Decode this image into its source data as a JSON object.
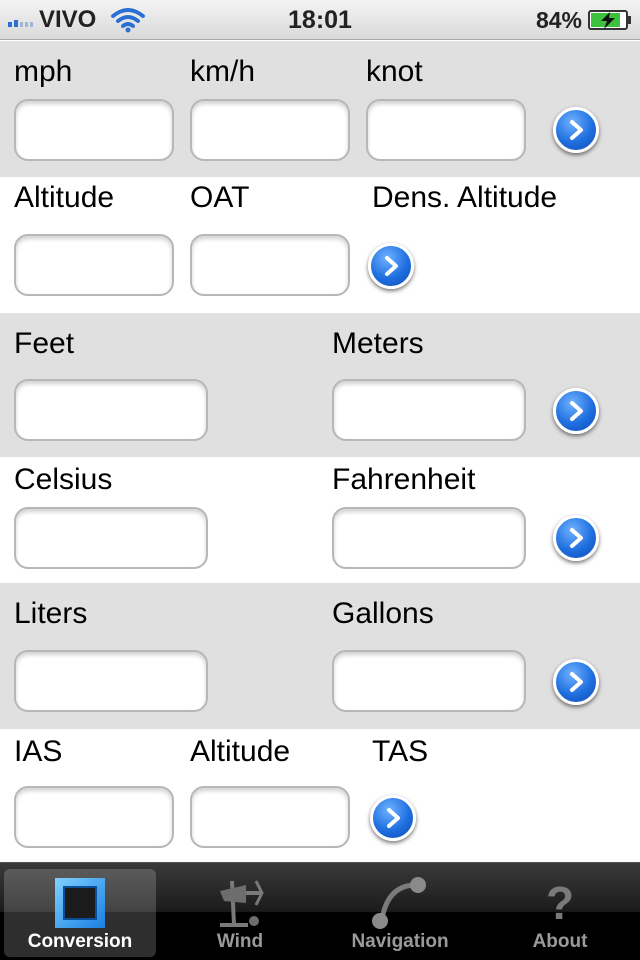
{
  "status_bar": {
    "carrier": "VIVO",
    "time": "18:01",
    "battery": "84%"
  },
  "rows": [
    {
      "labels": [
        "mph",
        "km/h",
        "knot"
      ]
    },
    {
      "labels": [
        "Altitude",
        "OAT",
        "Dens. Altitude"
      ]
    },
    {
      "labels": [
        "Feet",
        "Meters"
      ]
    },
    {
      "labels": [
        "Celsius",
        "Fahrenheit"
      ]
    },
    {
      "labels": [
        "Liters",
        "Gallons"
      ]
    },
    {
      "labels": [
        "IAS",
        "Altitude",
        "TAS"
      ]
    }
  ],
  "tabs": [
    {
      "label": "Conversion",
      "icon": "conversion-icon",
      "active": true
    },
    {
      "label": "Wind",
      "icon": "wind-icon"
    },
    {
      "label": "Navigation",
      "icon": "navigation-icon"
    },
    {
      "label": "About",
      "icon": "question-icon"
    }
  ],
  "colors": {
    "accent": "#1f6fe0",
    "section_grey": "#e0e0e0",
    "tab_active": "#ffffff"
  }
}
